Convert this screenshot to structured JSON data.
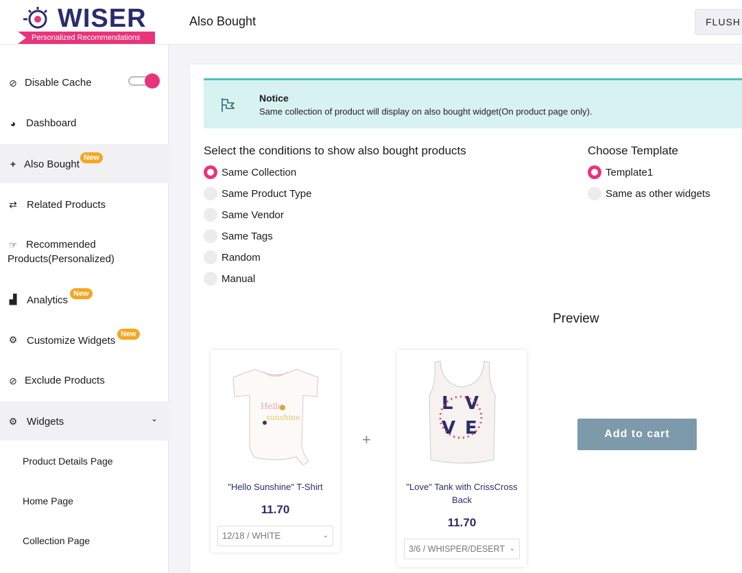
{
  "brand": {
    "name": "WISER",
    "tagline": "Personalized Recommendations",
    "accent_color": "#e8347a",
    "primary_color": "#2b2c6b"
  },
  "header": {
    "title": "Also Bought",
    "flush_label": "FLUSH"
  },
  "sidebar": {
    "items": [
      {
        "label": "Disable Cache",
        "icon": "ban-icon",
        "toggle_on": true
      },
      {
        "label": "Dashboard",
        "icon": "gauge-icon"
      },
      {
        "label": "Also Bought",
        "icon": "plus-icon",
        "badge": "New",
        "active": true
      },
      {
        "label": "Related Products",
        "icon": "retweet-icon"
      },
      {
        "label": "Recommended",
        "label2": "Products(Personalized)",
        "icon": "hand-pointing-icon"
      },
      {
        "label": "Analytics",
        "icon": "area-chart-icon",
        "badge": "New"
      },
      {
        "label": "Customize Widgets",
        "icon": "gears-icon",
        "badge": "New"
      },
      {
        "label": "Exclude Products",
        "icon": "ban-icon"
      },
      {
        "label": "Widgets",
        "icon": "gears-icon",
        "expanded": true
      }
    ],
    "sub_items": [
      "Product Details Page",
      "Home Page",
      "Collection Page"
    ]
  },
  "notice": {
    "title": "Notice",
    "text": "Same collection of product will display on also bought widget(On product page only)."
  },
  "conditions": {
    "title": "Select the conditions to show also bought products",
    "options": [
      "Same Collection",
      "Same Product Type",
      "Same Vendor",
      "Same Tags",
      "Random",
      "Manual"
    ],
    "selected": "Same Collection"
  },
  "template": {
    "title": "Choose Template",
    "options": [
      "Template1",
      "Same as other widgets"
    ],
    "selected": "Template1"
  },
  "preview": {
    "title": "Preview",
    "plus": "+",
    "add_to_cart": "Add to cart",
    "products": [
      {
        "name": "\"Hello Sunshine\" T-Shirt",
        "price": "11.70",
        "variant": "12/18 / WHITE"
      },
      {
        "name": "\"Love\" Tank with CrissCross Back",
        "price": "11.70",
        "variant": "3/6 / WHISPER/DESERT"
      }
    ]
  }
}
